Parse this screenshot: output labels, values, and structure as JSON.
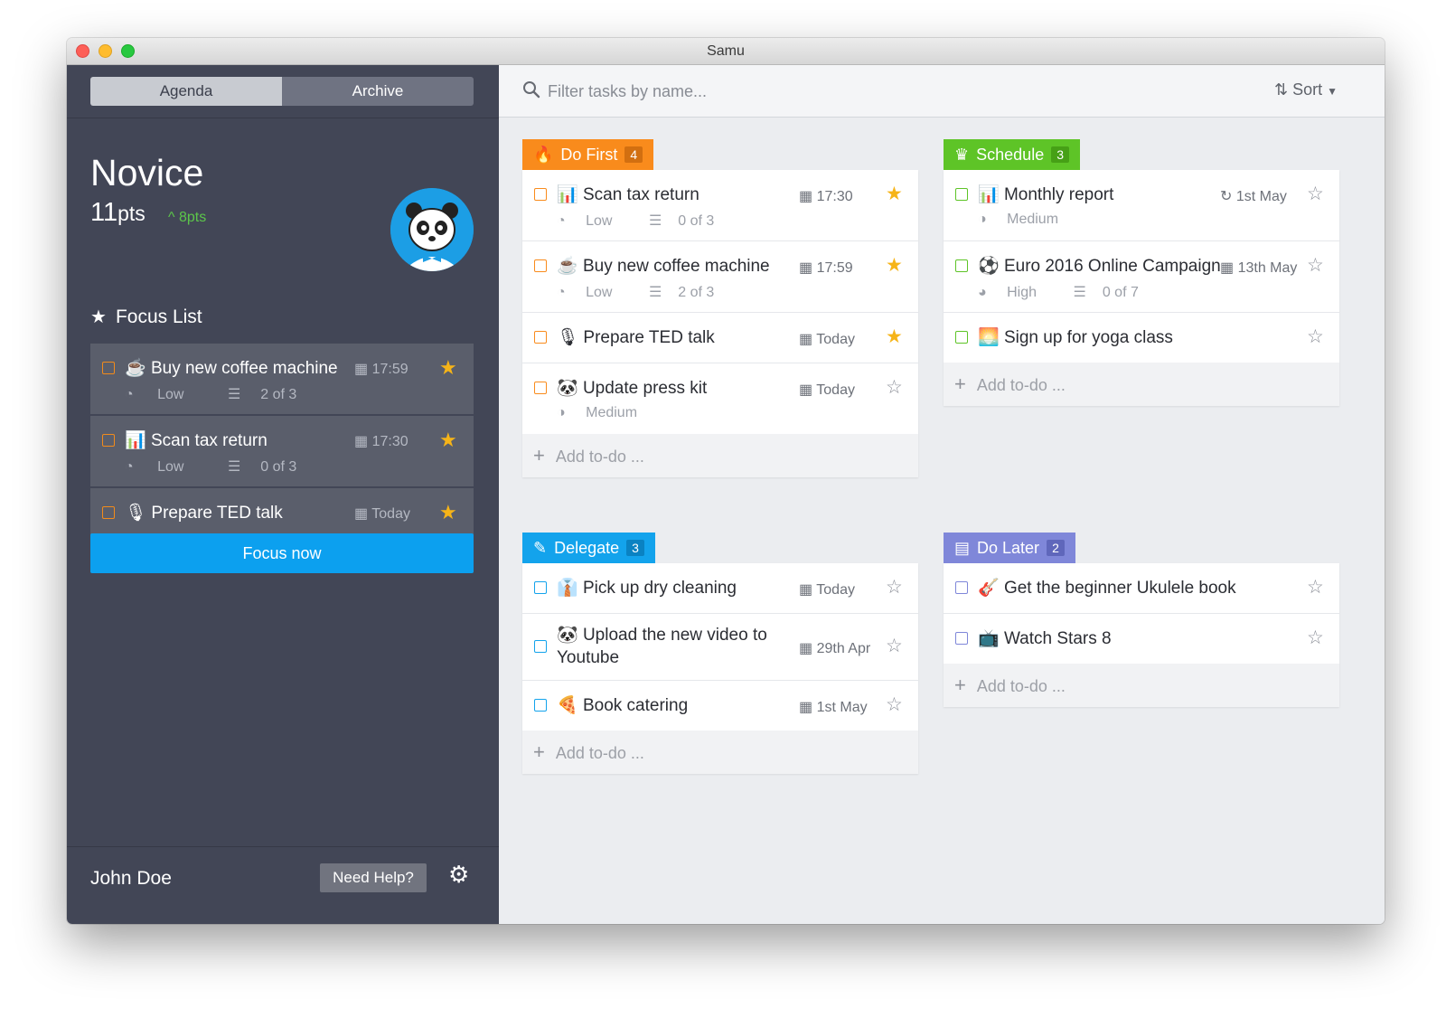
{
  "window": {
    "title": "Samu"
  },
  "sidebar": {
    "tabs": [
      {
        "label": "Agenda"
      },
      {
        "label": "Archive"
      }
    ],
    "level": "Novice",
    "points": "11",
    "points_unit": "pts",
    "points_delta": "8pts",
    "focus_title": "Focus List",
    "focus_items": [
      {
        "emoji": "☕",
        "title": "Buy new coffee machine",
        "date": "17:59",
        "starred": true,
        "priority": "Low",
        "subtasks": "2 of 3"
      },
      {
        "emoji": "📊",
        "title": "Scan tax return",
        "date": "17:30",
        "starred": true,
        "priority": "Low",
        "subtasks": "0 of 3"
      },
      {
        "emoji": "🎙",
        "title": "Prepare TED talk",
        "date": "Today",
        "starred": true
      }
    ],
    "focus_button": "Focus now",
    "user_name": "John Doe",
    "help_button": "Need Help?"
  },
  "toolbar": {
    "search_placeholder": "Filter tasks by name...",
    "sort_label": "Sort"
  },
  "quadrants": {
    "do_first": {
      "label": "Do First",
      "count": "4",
      "color": "#f98b1c",
      "tasks": [
        {
          "emoji": "📊",
          "title": "Scan tax return",
          "date": "17:30",
          "starred": true,
          "priority": "Low",
          "subtasks": "0 of 3"
        },
        {
          "emoji": "☕",
          "title": "Buy new coffee machine",
          "date": "17:59",
          "starred": true,
          "priority": "Low",
          "subtasks": "2 of 3"
        },
        {
          "emoji": "🎙",
          "title": "Prepare TED talk",
          "date": "Today",
          "starred": true
        },
        {
          "emoji": "🐼",
          "title": "Update press kit",
          "date": "Today",
          "starred": false,
          "priority": "Medium"
        }
      ],
      "add_label": "Add to-do ..."
    },
    "schedule": {
      "label": "Schedule",
      "count": "3",
      "color": "#5ec427",
      "tasks": [
        {
          "emoji": "📊",
          "title": "Monthly report",
          "date": "1st May",
          "repeat": true,
          "starred": false,
          "priority": "Medium"
        },
        {
          "emoji": "⚽",
          "title": "Euro 2016 Online Campaign",
          "date": "13th May",
          "starred": false,
          "priority": "High",
          "subtasks": "0 of 7"
        },
        {
          "emoji": "🌅",
          "title": "Sign up for yoga class",
          "starred": false
        }
      ],
      "add_label": "Add to-do ..."
    },
    "delegate": {
      "label": "Delegate",
      "count": "3",
      "color": "#13a3ec",
      "tasks": [
        {
          "emoji": "👔",
          "title": "Pick up dry cleaning",
          "date": "Today",
          "starred": false
        },
        {
          "emoji": "🐼",
          "title": "Upload the new video to Youtube",
          "date": "29th Apr",
          "starred": false
        },
        {
          "emoji": "🍕",
          "title": "Book catering",
          "date": "1st May",
          "starred": false
        }
      ],
      "add_label": "Add to-do ..."
    },
    "do_later": {
      "label": "Do Later",
      "count": "2",
      "color": "#7f87d9",
      "tasks": [
        {
          "emoji": "🎸",
          "title": "Get the beginner Ukulele book",
          "starred": false
        },
        {
          "emoji": "📺",
          "title": "Watch Stars 8",
          "starred": false
        }
      ],
      "add_label": "Add to-do ..."
    }
  },
  "icons": {
    "calendar": "calendar-icon",
    "star": "star-icon",
    "priority": "priority-icon",
    "checklist": "checklist-icon",
    "repeat": "repeat-icon",
    "search": "search-icon",
    "sort": "sort-icon",
    "gear": "gear-icon",
    "flame": "flame-icon",
    "crown": "crown-icon",
    "wand": "wand-icon",
    "archive": "archive-box-icon"
  }
}
